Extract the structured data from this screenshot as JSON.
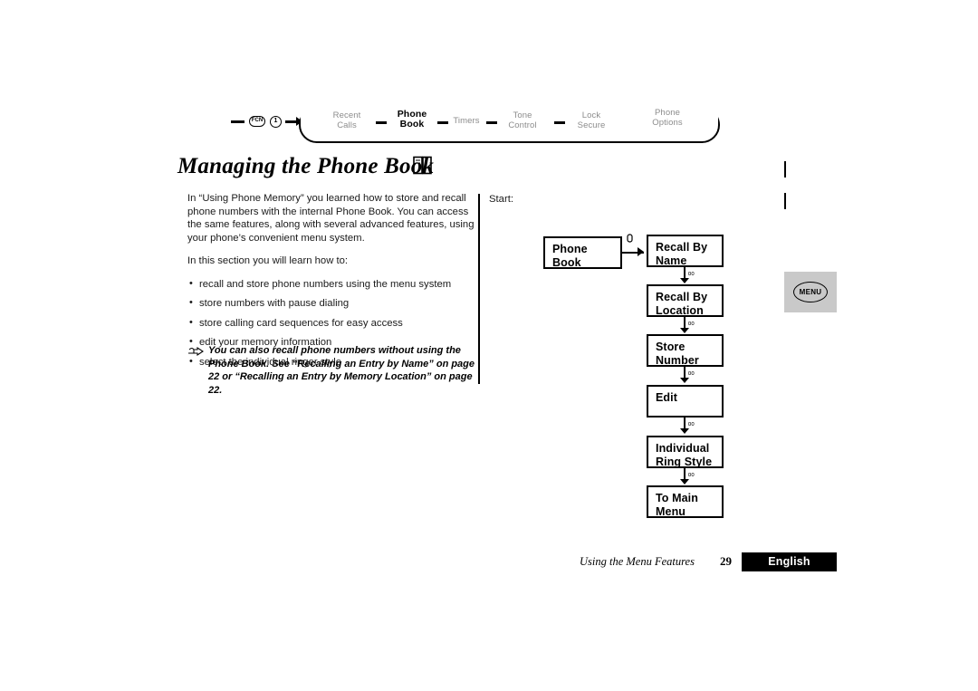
{
  "nav": {
    "keys": [
      {
        "name": "fcn-key",
        "label": "FCN"
      },
      {
        "name": "one-key",
        "label": "1"
      }
    ],
    "tabs": [
      {
        "line1": "Recent",
        "line2": "Calls",
        "current": false
      },
      {
        "line1": "Phone",
        "line2": "Book",
        "current": true
      },
      {
        "line1": "Timers",
        "line2": "",
        "current": false
      },
      {
        "line1": "Tone",
        "line2": "Control",
        "current": false
      },
      {
        "line1": "Lock",
        "line2": "Secure",
        "current": false
      },
      {
        "line1": "Phone",
        "line2": "Options",
        "current": false
      }
    ]
  },
  "title": "Managing the Phone Book",
  "title_icon": "phone-book-icon",
  "body": {
    "para1": "In “Using Phone Memory”  you learned how to store and recall phone numbers with the internal Phone Book. You can access the same features, along with several advanced features, using your phone’s convenient menu system.",
    "para2": "In this section you will learn how to:",
    "bullets": [
      "recall and store phone numbers using the menu system",
      "store numbers with pause dialing",
      "store calling card sequences for easy access",
      "edit your memory information",
      "select the individual ringer style"
    ],
    "note": "You can also recall phone numbers without using the Phone Book. See “Recalling an Entry by Name” on page 22 or “Recalling an Entry by Memory Location” on page 22."
  },
  "flow": {
    "start_label": "Start:",
    "boxes": [
      {
        "name": "phone-book",
        "line1": "Phone",
        "line2": "Book"
      },
      {
        "name": "recall-by-name",
        "line1": "Recall By",
        "line2": "Name"
      },
      {
        "name": "recall-by-location",
        "line1": "Recall By",
        "line2": "Location"
      },
      {
        "name": "store-number",
        "line1": "Store",
        "line2": "Number"
      },
      {
        "name": "edit",
        "line1": "Edit",
        "line2": ""
      },
      {
        "name": "individual-ring-style",
        "line1": "Individual",
        "line2": "Ring Style"
      },
      {
        "name": "to-main-menu",
        "line1": "To Main",
        "line2": "Menu"
      }
    ]
  },
  "menu_button": {
    "label": "MENU"
  },
  "footer": {
    "caption": "Using the Menu Features",
    "page": "29",
    "language": "English"
  }
}
